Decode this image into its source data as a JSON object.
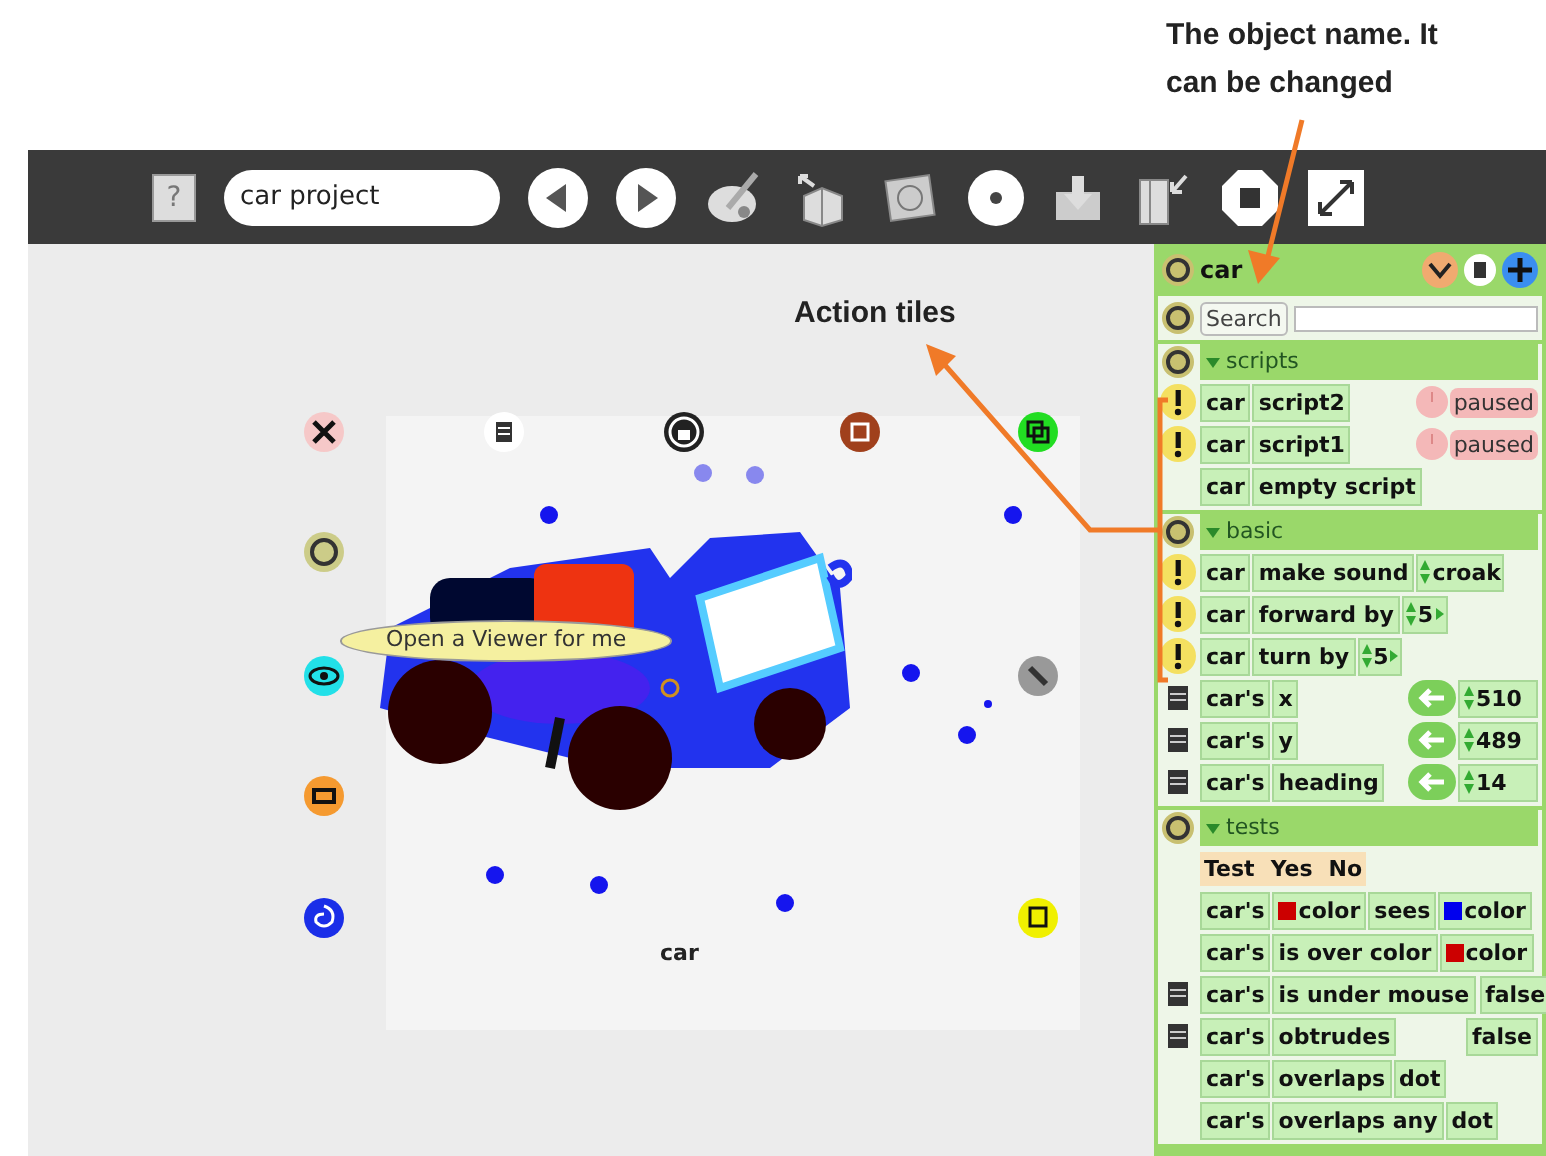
{
  "annotations": [
    {
      "text": "The object name. It can be changed"
    },
    {
      "text": "Action tiles"
    }
  ],
  "toolbar": {
    "help": "?",
    "project_name": "car project"
  },
  "canvas": {
    "balloon": "Open a Viewer for me",
    "object_label": "car"
  },
  "viewer": {
    "object_name": "car",
    "search": {
      "label": "Search"
    },
    "categories": [
      {
        "title": "scripts",
        "expanded": true,
        "rows": [
          {
            "kind": "script",
            "tiles": [
              {
                "text": "car"
              },
              {
                "text": "script2"
              }
            ],
            "status": "paused"
          },
          {
            "kind": "script",
            "tiles": [
              {
                "text": "car"
              },
              {
                "text": "script1"
              }
            ],
            "status": "paused"
          },
          {
            "kind": "tiles",
            "tiles": [
              {
                "text": "car"
              },
              {
                "text": "empty script"
              }
            ]
          }
        ]
      },
      {
        "title": "basic",
        "expanded": true,
        "rows": [
          {
            "kind": "command",
            "tiles": [
              {
                "text": "car"
              },
              {
                "text": "make sound"
              }
            ],
            "arg": "croak"
          },
          {
            "kind": "number_command",
            "tiles": [
              {
                "text": "car"
              },
              {
                "text": "forward by"
              }
            ],
            "arg": "5"
          },
          {
            "kind": "number_command",
            "tiles": [
              {
                "text": "car"
              },
              {
                "text": "turn by"
              }
            ],
            "arg": "5"
          },
          {
            "kind": "slot",
            "tiles": [
              {
                "text": "car's"
              },
              {
                "text": "x"
              }
            ],
            "value": "510"
          },
          {
            "kind": "slot",
            "tiles": [
              {
                "text": "car's"
              },
              {
                "text": "y"
              }
            ],
            "value": "489"
          },
          {
            "kind": "slot",
            "tiles": [
              {
                "text": "car's"
              },
              {
                "text": "heading"
              }
            ],
            "value": "14"
          }
        ]
      },
      {
        "title": "tests",
        "expanded": true,
        "rows": [
          {
            "kind": "test_header",
            "tiles": [
              {
                "text": "Test"
              },
              {
                "text": "Yes"
              },
              {
                "text": "No"
              }
            ]
          },
          {
            "kind": "tiles",
            "tiles": [
              {
                "text": "car's"
              },
              {
                "text": "color",
                "color": "#cc0000"
              },
              {
                "text": "sees"
              },
              {
                "text": "color",
                "color": "#0000ee"
              }
            ]
          },
          {
            "kind": "tiles",
            "tiles": [
              {
                "text": "car's"
              },
              {
                "text": "is over color"
              },
              {
                "text": "color",
                "color": "#cc0000"
              }
            ]
          },
          {
            "kind": "readout",
            "tiles": [
              {
                "text": "car's"
              },
              {
                "text": "is under mouse"
              }
            ],
            "value": "false"
          },
          {
            "kind": "readout",
            "tiles": [
              {
                "text": "car's"
              },
              {
                "text": "obtrudes"
              }
            ],
            "value": "false"
          },
          {
            "kind": "tiles",
            "tiles": [
              {
                "text": "car's"
              },
              {
                "text": "overlaps"
              },
              {
                "text": "dot"
              }
            ]
          },
          {
            "kind": "tiles",
            "tiles": [
              {
                "text": "car's"
              },
              {
                "text": "overlaps any"
              },
              {
                "text": "dot"
              }
            ]
          }
        ]
      }
    ]
  }
}
